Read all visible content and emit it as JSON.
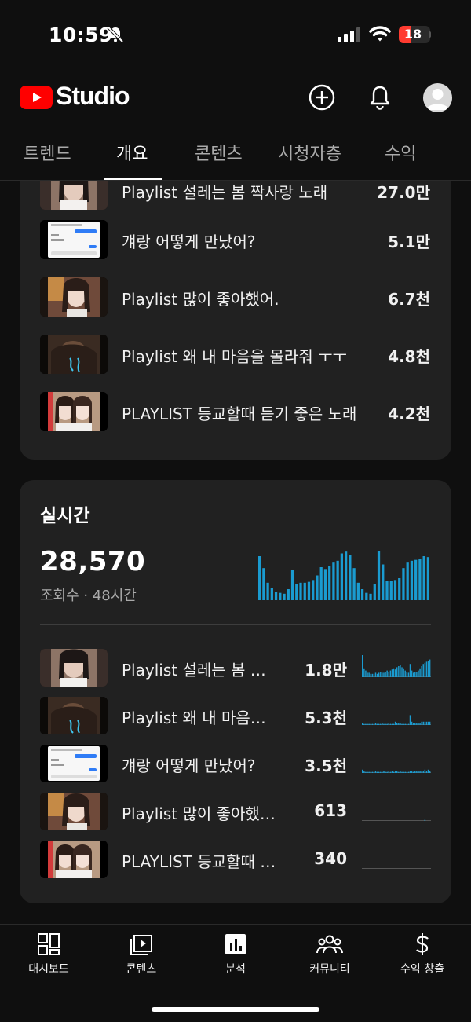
{
  "status_bar": {
    "time": "10:59",
    "battery_level": "18",
    "icons": [
      "bell-off-icon",
      "cellular-signal-icon",
      "wifi-icon",
      "battery-icon"
    ]
  },
  "header": {
    "logo_text": "Studio",
    "icons": [
      "youtube-play-icon",
      "create-plus-icon",
      "notifications-bell-icon",
      "account-avatar-icon"
    ],
    "brand_color": "#ff0000"
  },
  "tabs": [
    {
      "label": "트렌드",
      "active": false
    },
    {
      "label": "개요",
      "active": true
    },
    {
      "label": "콘텐츠",
      "active": false
    },
    {
      "label": "시청자층",
      "active": false
    },
    {
      "label": "수익",
      "active": false
    }
  ],
  "top_content": {
    "rows": [
      {
        "title": "Playlist 설레는 봄 짝사랑 노래",
        "value": "27.0만",
        "thumb": "girl-portrait"
      },
      {
        "title": "걔랑 어떻게 만났어?",
        "value": "5.1만",
        "thumb": "chat-screenshot"
      },
      {
        "title": "Playlist 많이 좋아했어.",
        "value": "6.7천",
        "thumb": "girl-portrait"
      },
      {
        "title": "Playlist 왜 내 마음을 몰라줘 ㅜㅜ",
        "value": "4.8천",
        "thumb": "dark-room"
      },
      {
        "title": "PLAYLIST 등교할때 듣기 좋은 노래",
        "value": "4.2천",
        "thumb": "two-girls"
      }
    ]
  },
  "realtime": {
    "title": "실시간",
    "views": "28,570",
    "caption": "조회수 · 48시간",
    "accent_color": "#1a9bd0",
    "hourly_bars": [
      48,
      35,
      19,
      13,
      9,
      8,
      7,
      12,
      33,
      18,
      19,
      19,
      20,
      22,
      27,
      36,
      34,
      37,
      41,
      43,
      51,
      53,
      49,
      35,
      19,
      12,
      8,
      7,
      18,
      54,
      39,
      21,
      21,
      22,
      24,
      35,
      41,
      43,
      44,
      45,
      48,
      47
    ],
    "rows": [
      {
        "title": "Playlist 설레는 봄 짝…",
        "value": "1.8만",
        "thumb": "girl-portrait",
        "spark": [
          20,
          8,
          6,
          4,
          4,
          3,
          3,
          3,
          4,
          3,
          4,
          5,
          4,
          4,
          5,
          6,
          5,
          6,
          7,
          8,
          7,
          9,
          10,
          11,
          9,
          8,
          6,
          5,
          4,
          12,
          6,
          4,
          5,
          5,
          6,
          8,
          10,
          12,
          13,
          14,
          15,
          16
        ]
      },
      {
        "title": "Playlist 왜 내 마음을…",
        "value": "5.3천",
        "thumb": "dark-room",
        "spark": [
          2,
          1,
          1,
          1,
          1,
          1,
          1,
          1,
          2,
          1,
          1,
          1,
          2,
          1,
          1,
          1,
          2,
          1,
          1,
          1,
          3,
          2,
          2,
          2,
          1,
          1,
          1,
          1,
          1,
          9,
          3,
          2,
          2,
          2,
          2,
          2,
          3,
          3,
          3,
          3,
          3,
          3
        ]
      },
      {
        "title": "걔랑 어떻게 만났어?",
        "value": "3.5천",
        "thumb": "chat-screenshot",
        "spark": [
          3,
          2,
          1,
          1,
          1,
          1,
          1,
          1,
          2,
          1,
          1,
          1,
          1,
          2,
          1,
          1,
          2,
          1,
          2,
          1,
          2,
          2,
          1,
          2,
          1,
          1,
          1,
          1,
          1,
          2,
          2,
          1,
          2,
          2,
          2,
          2,
          2,
          2,
          3,
          2,
          3,
          2
        ]
      },
      {
        "title": "Playlist 많이 좋아했어.",
        "value": "613",
        "thumb": "girl-portrait",
        "spark": [
          0,
          0,
          0,
          0,
          0,
          0,
          0,
          0,
          0,
          0,
          0,
          0,
          0,
          0,
          0,
          0,
          0,
          0,
          0,
          0,
          0,
          0,
          0,
          0,
          0,
          0,
          0,
          0,
          0,
          0,
          0,
          0,
          0,
          0,
          0,
          0,
          0,
          0,
          1,
          0,
          0,
          0
        ]
      },
      {
        "title": "PLAYLIST 등교할때 듣…",
        "value": "340",
        "thumb": "two-girls",
        "spark": [
          0,
          0,
          0,
          0,
          0,
          0,
          0,
          0,
          0,
          0,
          0,
          0,
          0,
          0,
          0,
          0,
          0,
          0,
          0,
          0,
          0,
          0,
          0,
          0,
          0,
          0,
          0,
          0,
          0,
          0,
          0,
          0,
          0,
          0,
          0,
          0,
          0,
          0,
          0,
          0,
          0,
          0
        ]
      }
    ]
  },
  "bottom_nav": [
    {
      "label": "대시보드",
      "icon": "dashboard-icon"
    },
    {
      "label": "콘텐츠",
      "icon": "content-play-icon"
    },
    {
      "label": "분석",
      "icon": "analytics-chart-icon"
    },
    {
      "label": "커뮤니티",
      "icon": "community-people-icon"
    },
    {
      "label": "수익 창출",
      "icon": "dollar-icon"
    }
  ]
}
